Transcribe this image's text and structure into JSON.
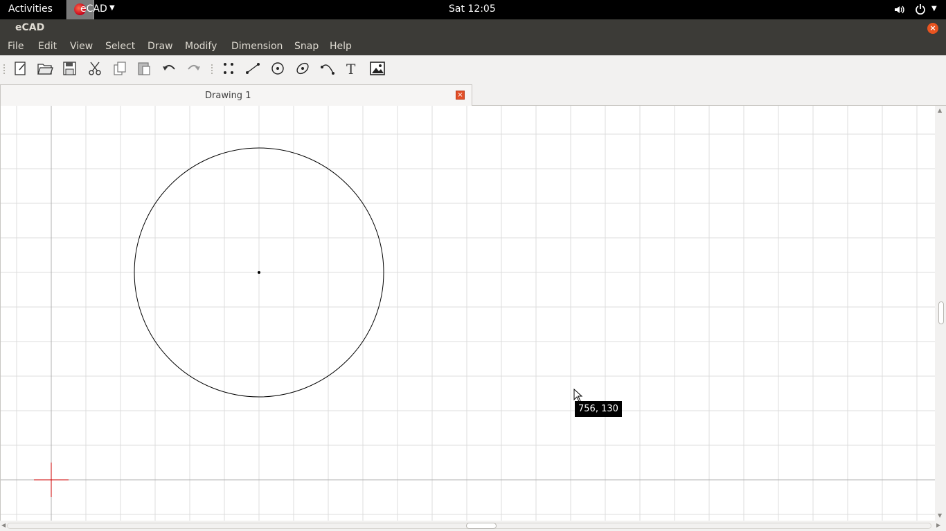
{
  "topbar": {
    "activities": "Activities",
    "app_menu": "eCAD",
    "clock": "Sat 12:05",
    "icons": [
      "volume-icon",
      "power-icon"
    ]
  },
  "window": {
    "title": "eCAD",
    "close_label": "×"
  },
  "menubar": {
    "items": [
      "File",
      "Edit",
      "View",
      "Select",
      "Draw",
      "Modify",
      "Dimension",
      "Snap",
      "Help"
    ]
  },
  "toolbar": {
    "tools": [
      "new-file",
      "open-file",
      "save-file",
      "cut",
      "copy",
      "paste",
      "undo",
      "redo",
      "draw-points",
      "draw-line",
      "draw-circle",
      "draw-ellipse",
      "draw-arc",
      "text",
      "image"
    ],
    "text_tool_label": "T"
  },
  "tab": {
    "title": "Drawing 1",
    "close_label": "×"
  },
  "canvas": {
    "cursor_coordinates": "756, 130",
    "colors": {
      "grid": "#dcdcdc",
      "origin_marker": "#cc0000",
      "shape": "#000000"
    }
  }
}
